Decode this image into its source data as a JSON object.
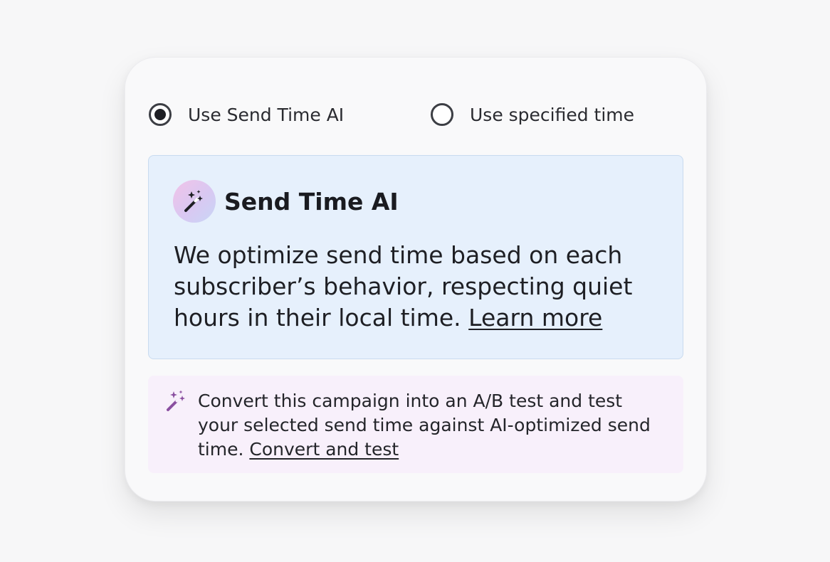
{
  "send_time": {
    "options": [
      {
        "label": "Use Send Time AI",
        "selected": true
      },
      {
        "label": "Use specified time",
        "selected": false
      }
    ]
  },
  "info": {
    "icon": "magic-wand-sparkles-icon",
    "title": "Send Time AI",
    "body": "We optimize send time based on each subscriber’s behavior, respecting quiet hours in their local time.",
    "link": "Learn more"
  },
  "promo": {
    "icon": "magic-wand-sparkles-icon",
    "text": "Convert this campaign into an A/B test and test your selected send time against AI-optimized send time.",
    "link": "Convert and test"
  },
  "colors": {
    "info_background": "#e6f0fc",
    "promo_background": "#f8f0fb",
    "promo_icon": "#8a4fa0"
  }
}
